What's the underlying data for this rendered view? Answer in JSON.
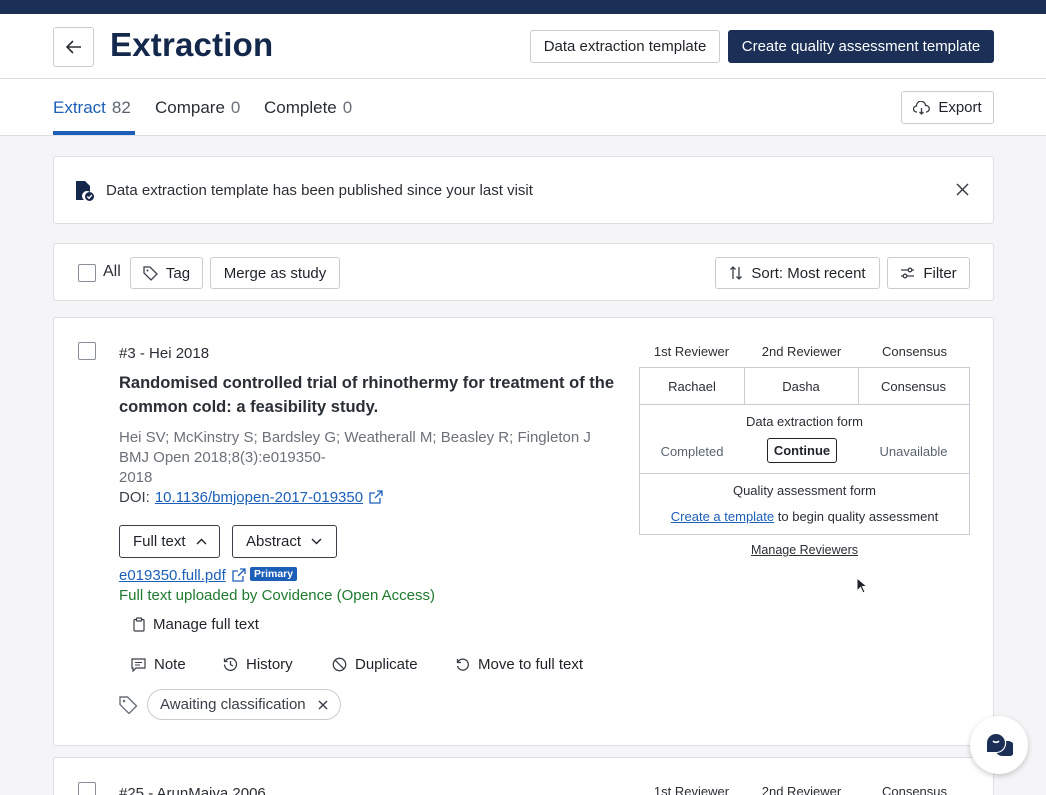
{
  "header": {
    "title": "Extraction",
    "data_extraction_template": "Data extraction template",
    "create_qa_template": "Create quality assessment template"
  },
  "tabs": [
    {
      "label": "Extract",
      "count": "82"
    },
    {
      "label": "Compare",
      "count": "0"
    },
    {
      "label": "Complete",
      "count": "0"
    }
  ],
  "export_label": "Export",
  "notice": {
    "text": "Data extraction template has been published since your last visit"
  },
  "toolbar": {
    "all_label": "All",
    "tag_label": "Tag",
    "merge_label": "Merge as study",
    "sort_label": "Sort: Most recent",
    "filter_label": "Filter"
  },
  "study": {
    "id": "#3 - Hei 2018",
    "title": "Randomised controlled trial of rhinothermy for treatment of the common cold: a feasibility study.",
    "authors": "Hei SV; McKinstry S; Bardsley G; Weatherall M; Beasley R; Fingleton J",
    "journal_line1": "BMJ Open 2018;8(3):e019350-",
    "journal_line2": "2018",
    "doi_label": "DOI:",
    "doi": "10.1136/bmjopen-2017-019350",
    "full_text_btn": "Full text",
    "abstract_btn": "Abstract",
    "pdf_name": "e019350.full.pdf",
    "primary_badge": "Primary",
    "uploaded_text": "Full text uploaded by Covidence (Open Access)",
    "manage_full_text": "Manage full text",
    "actions": {
      "note": "Note",
      "history": "History",
      "duplicate": "Duplicate",
      "move": "Move to full text"
    },
    "tag": "Awaiting classification"
  },
  "reviewers": {
    "headers": [
      "1st Reviewer",
      "2nd Reviewer",
      "Consensus"
    ],
    "names": [
      "Rachael",
      "Dasha",
      "Consensus"
    ],
    "de_form_title": "Data extraction form",
    "de_status": [
      "Completed",
      "Continue",
      "Unavailable"
    ],
    "qa_form_title": "Quality assessment form",
    "qa_link": "Create a template",
    "qa_suffix": "to begin quality assessment",
    "manage": "Manage Reviewers"
  },
  "study2": {
    "id": "#25 - ArunMaiya 2006",
    "headers": [
      "1st Reviewer",
      "2nd Reviewer",
      "Consensus"
    ]
  }
}
